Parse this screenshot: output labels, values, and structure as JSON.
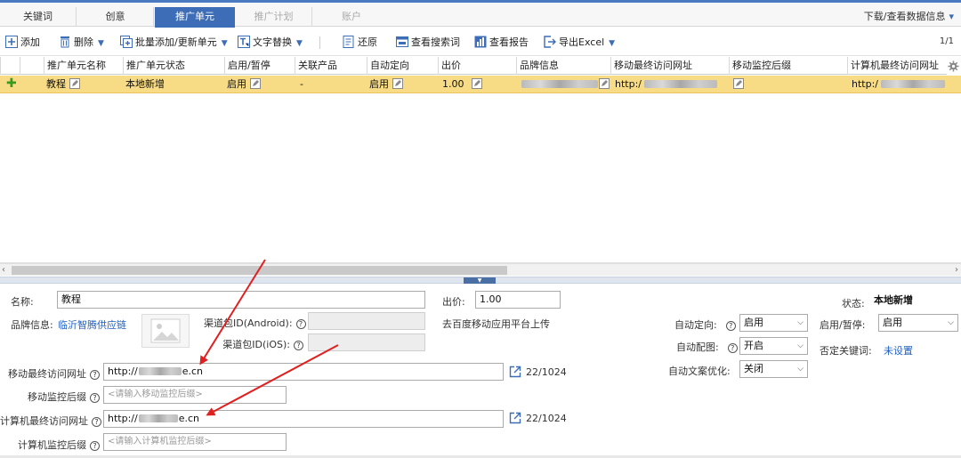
{
  "tabs": [
    {
      "label": "关键词",
      "state": "normal"
    },
    {
      "label": "创意",
      "state": "normal"
    },
    {
      "label": "推广单元",
      "state": "active"
    },
    {
      "label": "推广计划",
      "state": "disabled"
    },
    {
      "label": "账户",
      "state": "disabled"
    }
  ],
  "top_right": {
    "label": "下载/查看数据信息"
  },
  "toolbar": {
    "add": "添加",
    "delete": "删除",
    "batch": "批量添加/更新单元",
    "replace": "文字替换",
    "restore": "还原",
    "search_terms": "查看搜索词",
    "report": "查看报告",
    "export": "导出Excel",
    "page_info": "1/1"
  },
  "grid": {
    "headers": [
      "推广单元名称",
      "推广单元状态",
      "启用/暂停",
      "关联产品",
      "自动定向",
      "出价",
      "品牌信息",
      "移动最终访问网址",
      "移动监控后缀",
      "计算机最终访问网址"
    ],
    "row": {
      "name": "教程",
      "status": "本地新增",
      "enabled": "启用",
      "product": "-",
      "auto_target": "启用",
      "bid": "1.00",
      "mobile_url": "http:/",
      "pc_url": "http:/"
    }
  },
  "form": {
    "name_label": "名称:",
    "name_value": "教程",
    "bid_label": "出价:",
    "bid_value": "1.00",
    "status_label": "状态:",
    "status_value": "本地新增",
    "brand_label": "品牌信息:",
    "brand_link": "临沂智腾供应链",
    "android_label": "渠道包ID(Android):",
    "ios_label": "渠道包ID(iOS):",
    "upload_hint": "去百度移动应用平台上传",
    "auto_target_label": "自动定向:",
    "auto_target_value": "启用",
    "auto_image_label": "自动配图:",
    "auto_image_value": "开启",
    "auto_copy_label": "自动文案优化:",
    "auto_copy_value": "关闭",
    "enable_label": "启用/暂停:",
    "enable_value": "启用",
    "neg_kw_label": "否定关键词:",
    "neg_kw_link": "未设置",
    "mobile_url_label": "移动最终访问网址",
    "mobile_url_value": "http://",
    "mobile_url_tail": "e.cn",
    "mobile_counter": "22/1024",
    "mobile_suffix_label": "移动监控后缀",
    "mobile_suffix_placeholder": "<请输入移动监控后缀>",
    "pc_url_label": "计算机最终访问网址",
    "pc_url_value": "http://",
    "pc_url_tail": "e.cn",
    "pc_counter": "22/1024",
    "pc_suffix_label": "计算机监控后缀",
    "pc_suffix_placeholder": "<请输入计算机监控后缀>"
  },
  "colors": {
    "accent": "#3d6db7",
    "selected_row": "#f7dc85",
    "annotation_arrow": "#e02020",
    "link": "#1f5fc0"
  }
}
